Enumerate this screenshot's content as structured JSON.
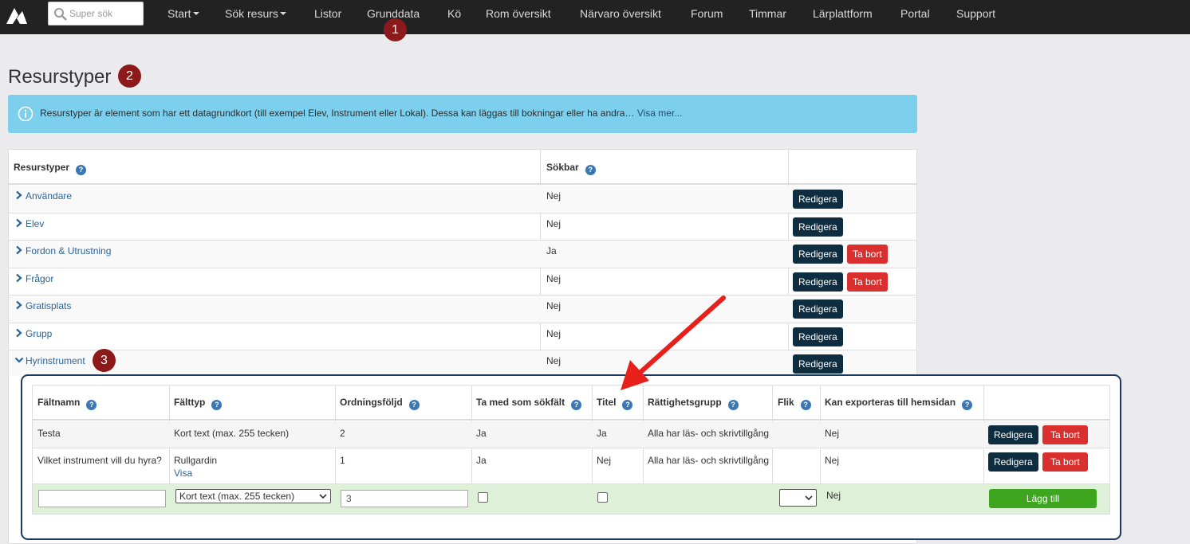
{
  "nav": {
    "search_placeholder": "Super sök",
    "items": [
      {
        "label": "Start"
      },
      {
        "label": "Sök resurs"
      },
      {
        "label": "Listor"
      },
      {
        "label": "Grunddata"
      },
      {
        "label": "Kö"
      },
      {
        "label": "Rom översikt"
      },
      {
        "label": "Närvaro översikt"
      },
      {
        "label": "Forum"
      },
      {
        "label": "Timmar"
      },
      {
        "label": "Lärplattform"
      },
      {
        "label": "Portal"
      },
      {
        "label": "Support"
      }
    ]
  },
  "badges": [
    "1",
    "2",
    "3"
  ],
  "page": {
    "title": "Resurstyper",
    "alert_text": "Resurstyper är element som har ett datagrundkort (till exempel Elev, Instrument eller Lokal). Dessa kan läggas till bokningar eller ha andra…",
    "alert_more": "Visa mer..."
  },
  "outer_table": {
    "headers": {
      "name": "Resurstyper",
      "searchable": "Sökbar"
    },
    "rows": [
      {
        "name": "Användare",
        "searchable": "Nej",
        "edit": "Redigera"
      },
      {
        "name": "Elev",
        "searchable": "Nej",
        "edit": "Redigera"
      },
      {
        "name": "Fordon & Utrustning",
        "searchable": "Ja",
        "edit": "Redigera",
        "delete": "Ta bort"
      },
      {
        "name": "Frågor",
        "searchable": "Nej",
        "edit": "Redigera",
        "delete": "Ta bort"
      },
      {
        "name": "Gratisplats",
        "searchable": "Nej",
        "edit": "Redigera"
      },
      {
        "name": "Grupp",
        "searchable": "Nej",
        "edit": "Redigera"
      },
      {
        "name": "Hyrinstrument",
        "searchable": "Nej",
        "edit": "Redigera"
      }
    ]
  },
  "inner_table": {
    "headers": {
      "field_name": "Fältnamn",
      "field_type": "Fälttyp",
      "order": "Ordningsföljd",
      "search_field": "Ta med som sökfält",
      "title": "Titel",
      "rights": "Rättighetsgrupp",
      "tab": "Flik",
      "export": "Kan exporteras till hemsidan"
    },
    "rows": [
      {
        "field_name": "Testa",
        "field_type": "Kort text (max. 255 tecken)",
        "order": "2",
        "search_field": "Ja",
        "title": "Ja",
        "rights": "Alla har läs- och skrivtillgång",
        "tab": "",
        "export": "Nej",
        "edit": "Redigera",
        "delete": "Ta bort"
      },
      {
        "field_name": "Vilket instrument vill du hyra?",
        "field_type": "Rullgardin",
        "field_type_link": "Visa",
        "order": "1",
        "search_field": "Ja",
        "title": "Nej",
        "rights": "Alla har läs- och skrivtillgång",
        "tab": "",
        "export": "Nej",
        "edit": "Redigera",
        "delete": "Ta bort"
      }
    ],
    "add_row": {
      "field_name_value": "",
      "field_type_selected": "Kort text (max. 255 tecken)",
      "order_value": "3",
      "search_field_checked": false,
      "title_checked": false,
      "tab_selected": "",
      "export": "Nej",
      "add_label": "Lägg till"
    }
  },
  "colors": {
    "navbar": "#222222",
    "badge": "#8c1a1a",
    "alert": "#7cd0ee",
    "btn_dark": "#0f2d40",
    "btn_red": "#d9302f",
    "btn_green": "#3ea51f",
    "panel_border": "#1c3a5e",
    "annotation_arrow": "#e8201c"
  },
  "icons": [
    "app-logo-icon",
    "search-icon",
    "info-icon",
    "help-icon",
    "chevron-right-icon",
    "chevron-down-icon",
    "select-arrow-icon",
    "annotation-arrow-icon"
  ]
}
